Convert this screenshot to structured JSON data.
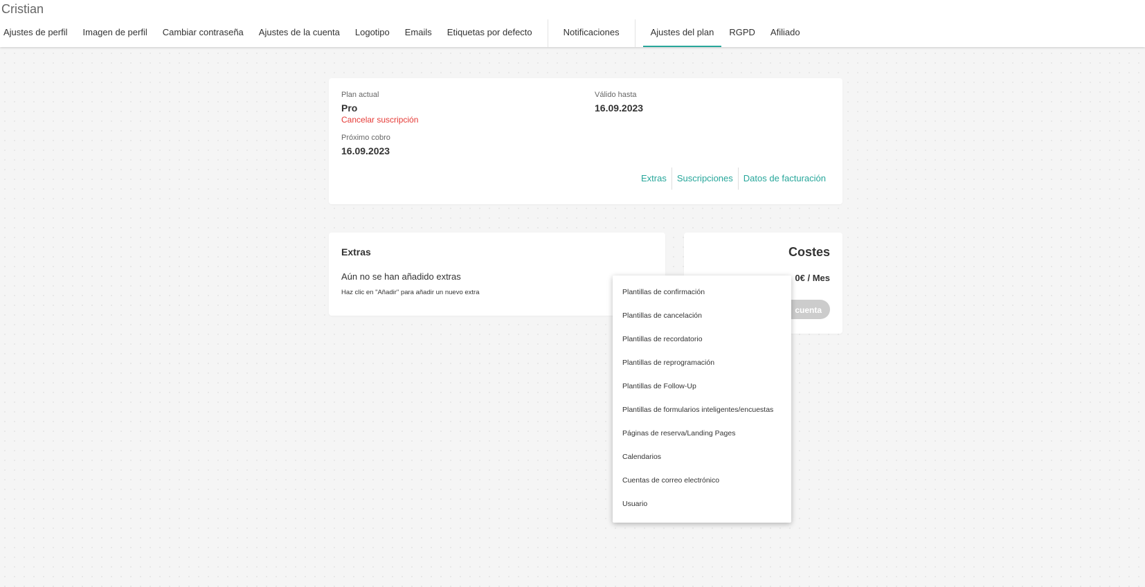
{
  "header": {
    "user_name": "Cristian",
    "tabs": [
      {
        "label": "Ajustes de perfil"
      },
      {
        "label": "Imagen de perfil"
      },
      {
        "label": "Cambiar contraseña"
      },
      {
        "label": "Ajustes de la cuenta"
      },
      {
        "label": "Logotipo"
      },
      {
        "label": "Emails"
      },
      {
        "label": "Etiquetas por defecto"
      },
      {
        "label": "Notificaciones"
      },
      {
        "label": "Ajustes del plan",
        "active": true
      },
      {
        "label": "RGPD"
      },
      {
        "label": "Afiliado"
      }
    ]
  },
  "plan": {
    "current_label": "Plan actual",
    "current_value": "Pro",
    "cancel_label": "Cancelar suscripción",
    "valid_label": "Válido hasta",
    "valid_value": "16.09.2023",
    "next_charge_label": "Próximo cobro",
    "next_charge_value": "16.09.2023",
    "links": {
      "extras": "Extras",
      "subscriptions": "Suscripciones",
      "billing": "Datos de facturación"
    }
  },
  "extras": {
    "title": "Extras",
    "empty_text": "Aún no se han añadido extras",
    "hint": "Haz clic en \"Añadir\" para añadir un nuevo extra"
  },
  "costs": {
    "title": "Costes",
    "price": "0€ / Mes",
    "button_label": "cuenta"
  },
  "dropdown": {
    "items": [
      "Plantillas de confirmación",
      "Plantillas de cancelación",
      "Plantillas de recordatorio",
      "Plantillas de reprogramación",
      "Plantillas de Follow-Up",
      "Plantillas de formularios inteligentes/encuestas",
      "Páginas de reserva/Landing Pages",
      "Calendarios",
      "Cuentas de correo electrónico",
      "Usuario"
    ]
  },
  "colors": {
    "accent": "#26a69a",
    "danger": "#e53935",
    "disabled_button": "#cccccc",
    "background": "#f5f5f5"
  }
}
